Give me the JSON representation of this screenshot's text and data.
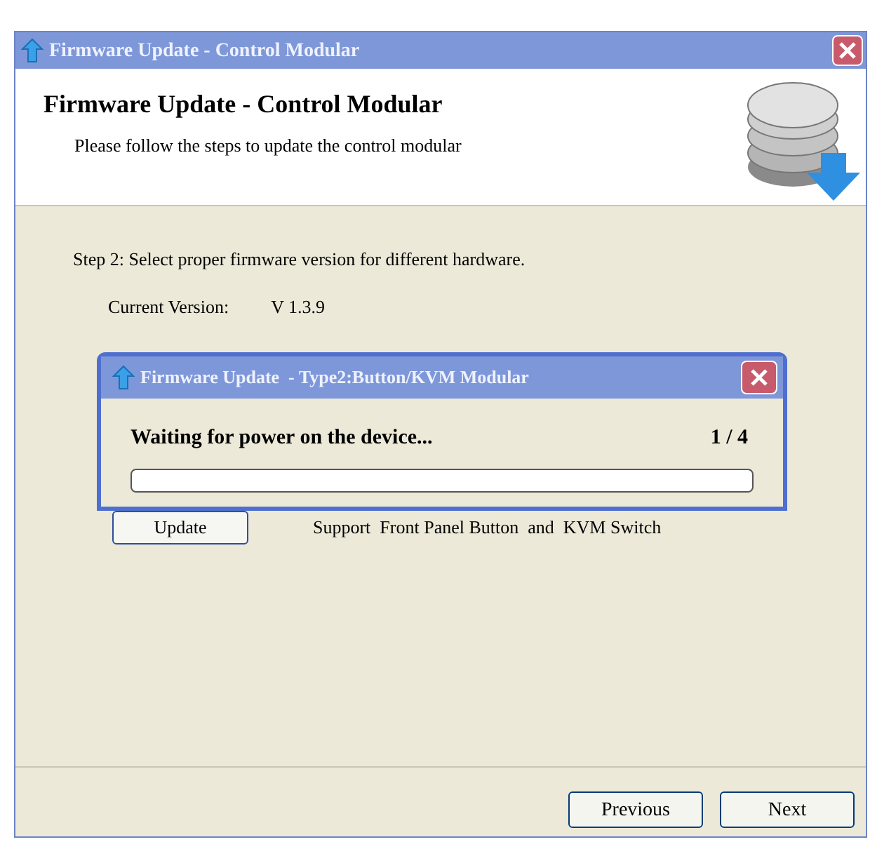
{
  "window": {
    "title": "Firmware Update - Control Modular"
  },
  "header": {
    "title": "Firmware Update - Control Modular",
    "subtitle": "Please follow the steps to update the control modular"
  },
  "step": "Step 2: Select proper firmware version for different hardware.",
  "current_version": {
    "label": "Current Version:",
    "value": "V 1.3.9"
  },
  "update_row": {
    "button": "Update",
    "description": "Support  Front Panel Button  and  KVM Switch"
  },
  "dialog": {
    "title": "Firmware Update  - Type2:Button/KVM Modular",
    "message": "Waiting for power on the device...",
    "counter": "1 / 4",
    "level": 0
  },
  "buttons": [
    "Previous",
    "Next"
  ]
}
